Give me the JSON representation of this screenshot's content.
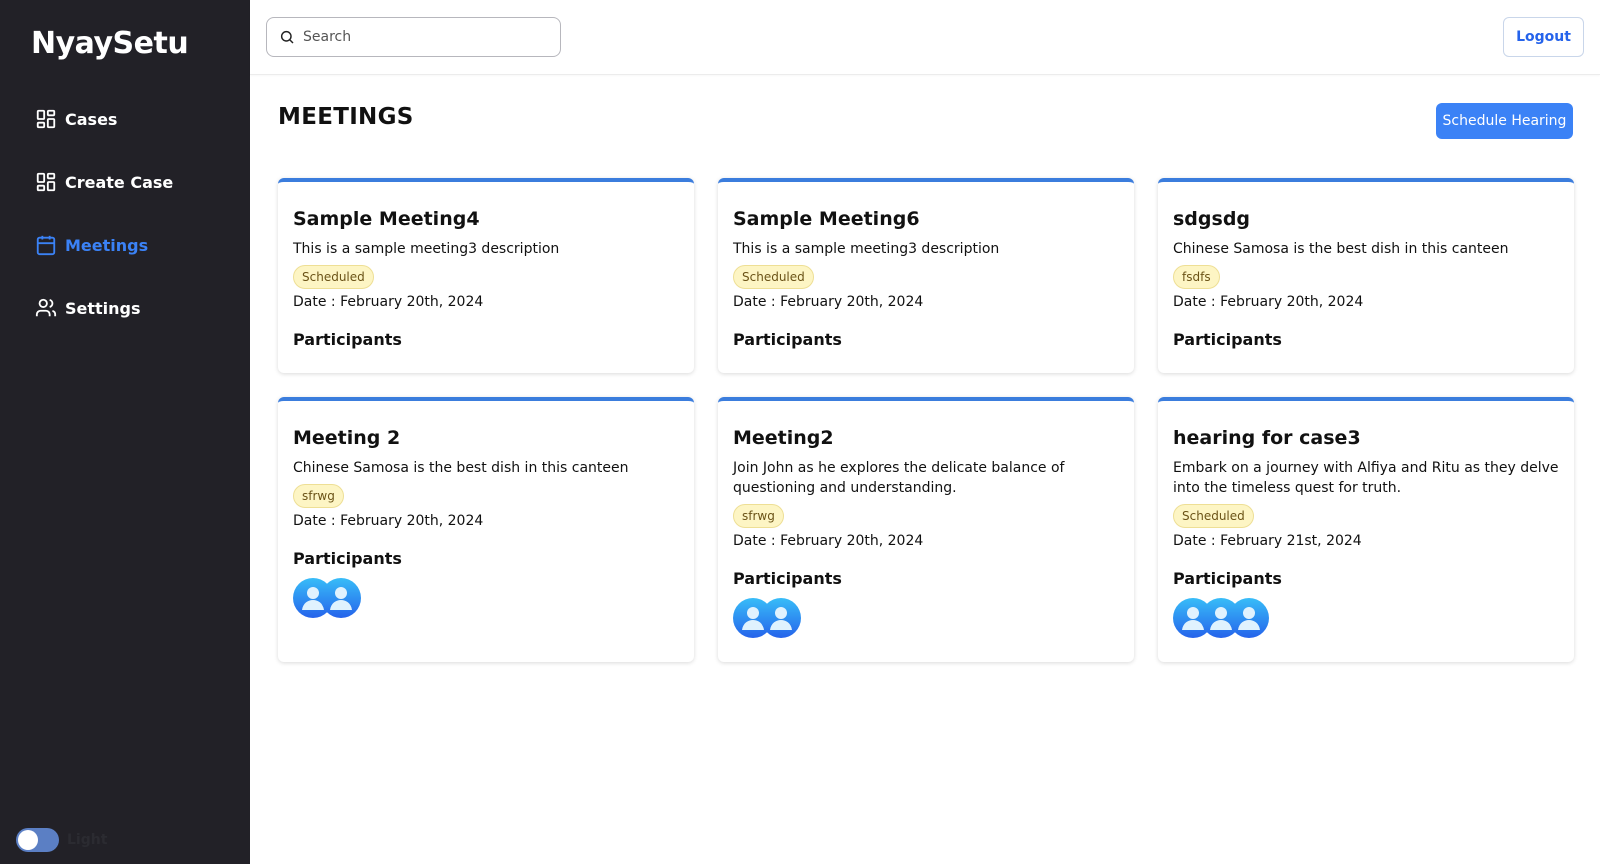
{
  "app": {
    "brand": "NyaySetu"
  },
  "sidebar": {
    "items": [
      {
        "label": "Cases",
        "icon": "grid-icon",
        "active": false
      },
      {
        "label": "Create Case",
        "icon": "grid-icon",
        "active": false
      },
      {
        "label": "Meetings",
        "icon": "calendar-icon",
        "active": true
      },
      {
        "label": "Settings",
        "icon": "users-icon",
        "active": false
      }
    ],
    "theme_toggle": {
      "label": "Light"
    }
  },
  "topbar": {
    "search_placeholder": "Search",
    "logout_label": "Logout"
  },
  "page": {
    "title": "MEETINGS",
    "schedule_button": "Schedule Hearing",
    "participants_heading": "Participants"
  },
  "colors": {
    "accent": "#3b82f6",
    "sidebar_bg": "#222127",
    "card_border": "#3b7ddd",
    "badge_bg": "#fdf5c4"
  },
  "meetings": [
    {
      "title": "Sample Meeting4",
      "description": "This is a sample meeting3 description",
      "status": "Scheduled",
      "date": "Date : February 20th, 2024",
      "participants": 0
    },
    {
      "title": "Sample Meeting6",
      "description": "This is a sample meeting3 description",
      "status": "Scheduled",
      "date": "Date : February 20th, 2024",
      "participants": 0
    },
    {
      "title": "sdgsdg",
      "description": "Chinese Samosa is the best dish in this canteen",
      "status": "fsdfs",
      "date": "Date : February 20th, 2024",
      "participants": 0
    },
    {
      "title": "Meeting 2",
      "description": "Chinese Samosa is the best dish in this canteen",
      "status": "sfrwg",
      "date": "Date : February 20th, 2024",
      "participants": 2
    },
    {
      "title": "Meeting2",
      "description": "Join John as he explores the delicate balance of questioning and understanding.",
      "status": "sfrwg",
      "date": "Date : February 20th, 2024",
      "participants": 2
    },
    {
      "title": "hearing for case3",
      "description": "Embark on a journey with Alfiya and Ritu as they delve into the timeless quest for truth.",
      "status": "Scheduled",
      "date": "Date : February 21st, 2024",
      "participants": 3
    }
  ]
}
